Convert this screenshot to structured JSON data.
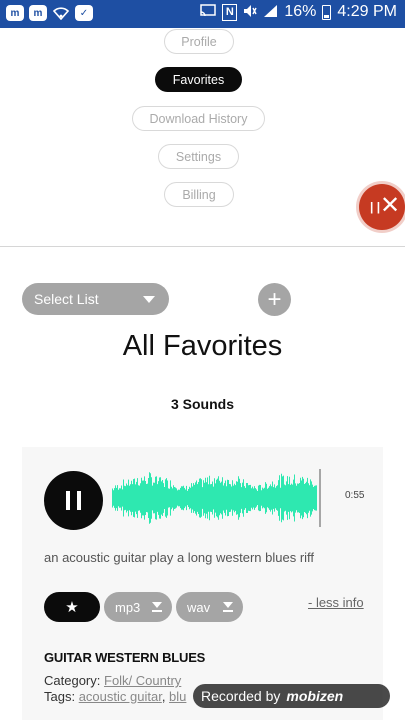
{
  "status_bar": {
    "left_icons": [
      "message-icon",
      "message-icon",
      "wifi-icon",
      "shopping-bag-icon"
    ],
    "battery": "16%",
    "time": "4:29 PM"
  },
  "nav": {
    "items": [
      {
        "label": "Profile",
        "active": false
      },
      {
        "label": "Favorites",
        "active": true
      },
      {
        "label": "Download History",
        "active": false
      },
      {
        "label": "Settings",
        "active": false
      },
      {
        "label": "Billing",
        "active": false
      }
    ]
  },
  "toolbar": {
    "select_label": "Select List",
    "add_label": "+"
  },
  "page": {
    "title": "All Favorites",
    "sound_count": "3 Sounds"
  },
  "sound": {
    "duration": "0:55",
    "description": "an acoustic guitar play a long western blues riff",
    "favorite_icon": "★",
    "formats": [
      "mp3",
      "wav"
    ],
    "less_info": "- less info",
    "title": "GUITAR WESTERN BLUES",
    "category_label": "Category:",
    "category_value": "Folk/ Country",
    "tags_label": "Tags:",
    "tags": [
      "acoustic guitar",
      "blu"
    ],
    "waveform_color": "#2ee8b0"
  },
  "watermark": {
    "text": "Recorded by",
    "brand": "mobizen"
  },
  "colors": {
    "status_bar": "#1e4fa3",
    "active_pill": "#0b0b0b",
    "grey_button": "#a5a5a5",
    "recorder_bubble": "#c63a22"
  }
}
